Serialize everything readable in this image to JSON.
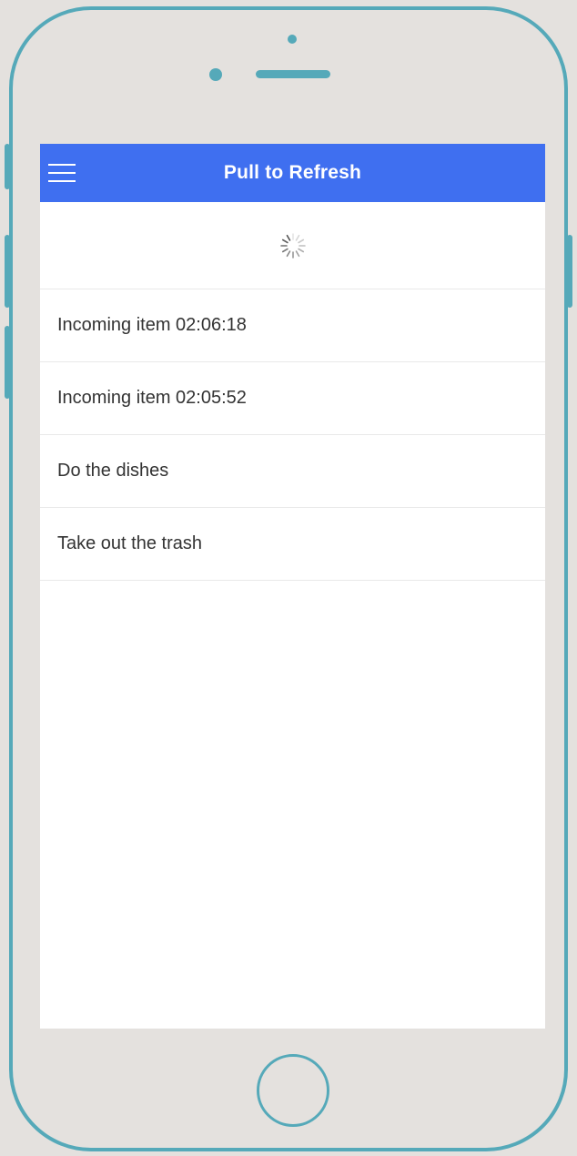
{
  "header": {
    "title": "Pull to Refresh",
    "menu_icon": "hamburger-menu-icon"
  },
  "refresher": {
    "icon": "loading-spinner-icon"
  },
  "list": {
    "items": [
      {
        "label": "Incoming item 02:06:18"
      },
      {
        "label": "Incoming item 02:05:52"
      },
      {
        "label": "Do the dishes"
      },
      {
        "label": "Take out the trash"
      }
    ]
  },
  "colors": {
    "accent": "#3f6ff0",
    "device_outline": "#55a9b9"
  }
}
